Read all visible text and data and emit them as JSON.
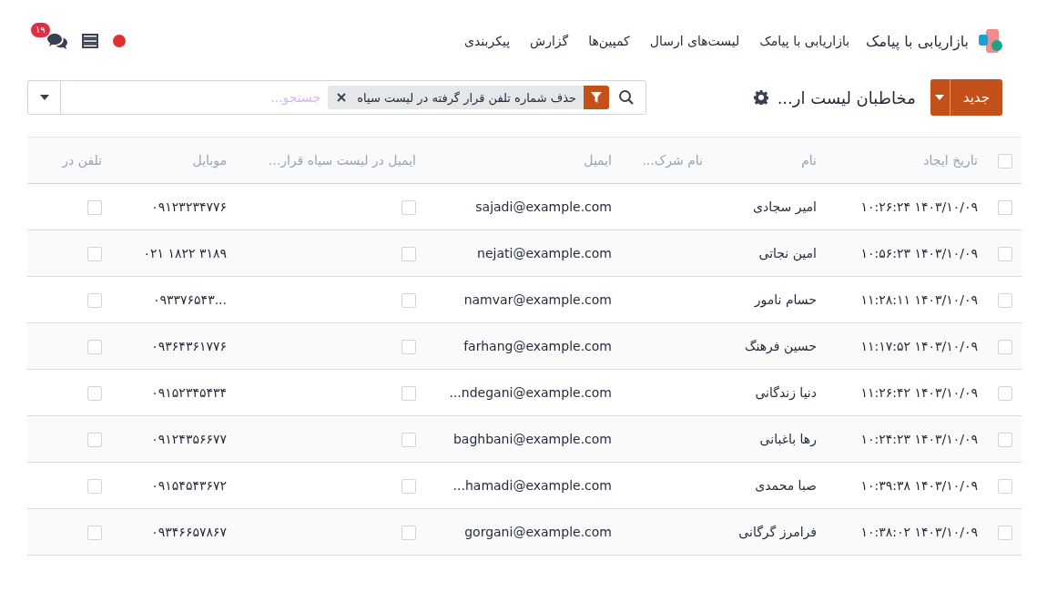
{
  "navbar": {
    "app_name": "بازاریابی با پیامک",
    "menu": [
      {
        "label": "بازاریابی با پیامک"
      },
      {
        "label": "لیست‌های ارسال"
      },
      {
        "label": "کمپین‌ها"
      },
      {
        "label": "گزارش"
      },
      {
        "label": "پیکربندی"
      }
    ],
    "messages_badge": "۱۹"
  },
  "control_panel": {
    "new_button": "جدید",
    "breadcrumb": "مخاطبان لیست ار...",
    "search": {
      "facet": "حذف شماره تلفن قرار گرفته در لیست سیاه",
      "placeholder": "جستجو..."
    }
  },
  "table": {
    "select_all": {
      "selected": false
    },
    "columns": [
      "تاریخ ایجاد",
      "نام",
      "نام شرک...",
      "ایمیل",
      "ایمیل در لیست سیاه قرار...",
      "موبایل",
      "تلفن در"
    ],
    "rows": [
      {
        "selected": false,
        "created": "۱۴۰۳/۱۰/۰۹ ۱۰:۲۶:۲۴",
        "name": "امیر سجادی",
        "email": "sajadi@example.com",
        "email_blacklisted": false,
        "mobile": "۰۹۱۲۳۲۳۴۷۷۶",
        "phone_blacklisted": false
      },
      {
        "selected": false,
        "created": "۱۴۰۳/۱۰/۰۹ ۱۰:۵۶:۲۳",
        "name": "امین نجاتی",
        "email": "nejati@example.com",
        "email_blacklisted": false,
        "mobile": "۰۲۱ ۱۸۲۲ ۳۱۸۹",
        "phone_blacklisted": false
      },
      {
        "selected": false,
        "created": "۱۴۰۳/۱۰/۰۹ ۱۱:۲۸:۱۱",
        "name": "حسام نامور",
        "email": "namvar@example.com",
        "email_blacklisted": false,
        "mobile": "۰۹۳۳۷۶۵۴۳...",
        "phone_blacklisted": false
      },
      {
        "selected": false,
        "created": "۱۴۰۳/۱۰/۰۹ ۱۱:۱۷:۵۲",
        "name": "حسین فرهنگ",
        "email": "farhang@example.com",
        "email_blacklisted": false,
        "mobile": "۰۹۳۶۴۳۶۱۷۷۶",
        "phone_blacklisted": false
      },
      {
        "selected": false,
        "created": "۱۴۰۳/۱۰/۰۹ ۱۱:۲۶:۴۲",
        "name": "دنیا زندگانی",
        "email": "...ndegani@example.com",
        "email_blacklisted": false,
        "mobile": "۰۹۱۵۲۳۴۵۴۳۴",
        "phone_blacklisted": false
      },
      {
        "selected": false,
        "created": "۱۴۰۳/۱۰/۰۹ ۱۰:۲۴:۲۳",
        "name": "رها باغبانی",
        "email": "baghbani@example.com",
        "email_blacklisted": false,
        "mobile": "۰۹۱۲۴۳۵۶۶۷۷",
        "phone_blacklisted": false
      },
      {
        "selected": false,
        "created": "۱۴۰۳/۱۰/۰۹ ۱۰:۳۹:۳۸",
        "name": "صبا محمدی",
        "email": "...hamadi@example.com",
        "email_blacklisted": false,
        "mobile": "۰۹۱۵۴۵۴۳۶۷۲",
        "phone_blacklisted": false
      },
      {
        "selected": false,
        "created": "۱۴۰۳/۱۰/۰۹ ۱۰:۳۸:۰۲",
        "name": "فرامرز گرگانی",
        "email": "gorgani@example.com",
        "email_blacklisted": false,
        "mobile": "۰۹۳۴۶۶۵۷۸۶۷",
        "phone_blacklisted": false
      }
    ]
  }
}
